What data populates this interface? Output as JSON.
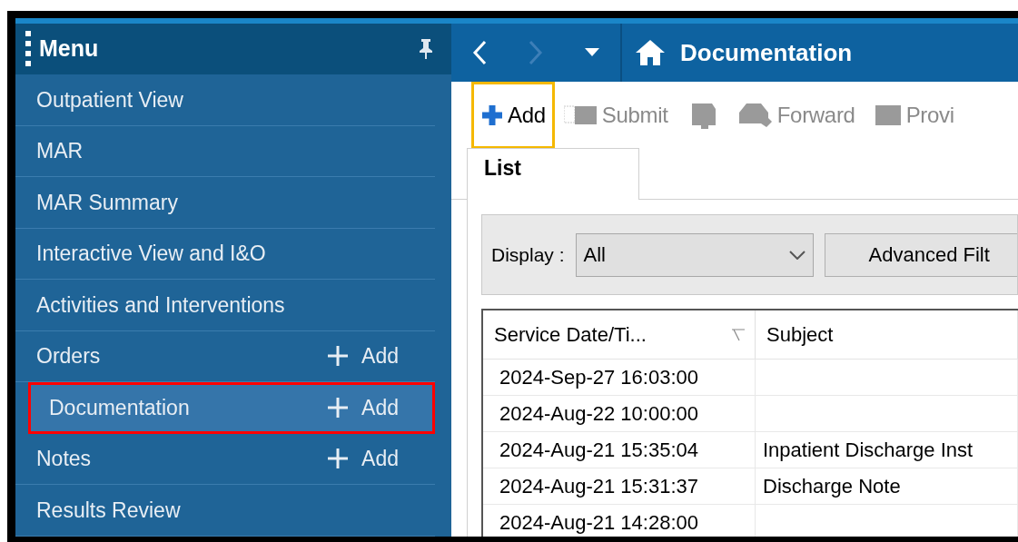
{
  "menu": {
    "title": "Menu",
    "items": [
      {
        "label": "Outpatient View",
        "selected": false,
        "highlighted": false
      },
      {
        "label": "MAR",
        "selected": false,
        "highlighted": false
      },
      {
        "label": "MAR Summary",
        "selected": false,
        "highlighted": false
      },
      {
        "label": "Interactive View and I&O",
        "selected": false,
        "highlighted": false
      },
      {
        "label": "Activities and Interventions",
        "selected": false,
        "highlighted": false
      },
      {
        "label": "Orders",
        "add": "Add",
        "selected": false,
        "highlighted": false
      },
      {
        "label": "Documentation",
        "add": "Add",
        "selected": true,
        "highlighted": true
      },
      {
        "label": "Notes",
        "add": "Add",
        "selected": false,
        "highlighted": false
      },
      {
        "label": "Results Review",
        "selected": false,
        "highlighted": false
      }
    ]
  },
  "nav": {
    "title": "Documentation",
    "buttons": [
      {
        "kind": "back",
        "disabled": false
      },
      {
        "kind": "forward",
        "disabled": true
      },
      {
        "kind": "dropdown",
        "disabled": false
      }
    ]
  },
  "toolbar": [
    {
      "kind": "add",
      "label": "Add",
      "disabled": false,
      "highlighted": true
    },
    {
      "kind": "submit",
      "label": "Submit",
      "disabled": true,
      "highlighted": false
    },
    {
      "kind": "sign",
      "disabled": true,
      "highlighted": false
    },
    {
      "kind": "forward",
      "label": "Forward",
      "disabled": true,
      "highlighted": false
    },
    {
      "kind": "provider",
      "label": "Provi",
      "disabled": true,
      "highlighted": false
    }
  ],
  "tabs": [
    {
      "label": "List",
      "selected": true
    }
  ],
  "filter": {
    "label": "Display :",
    "value": "All",
    "button": "Advanced Filt"
  },
  "table": {
    "columns": [
      {
        "label": "Service Date/Ti...",
        "sorted": true
      },
      {
        "label": "Subject",
        "sorted": false
      }
    ],
    "rows": [
      [
        "2024-Sep-27 16:03:00",
        ""
      ],
      [
        "2024-Aug-22 10:00:00",
        ""
      ],
      [
        "2024-Aug-21 15:35:04",
        "Inpatient Discharge Inst"
      ],
      [
        "2024-Aug-21 15:31:37",
        "Discharge Note"
      ],
      [
        "2024-Aug-21 14:28:00",
        ""
      ]
    ]
  }
}
